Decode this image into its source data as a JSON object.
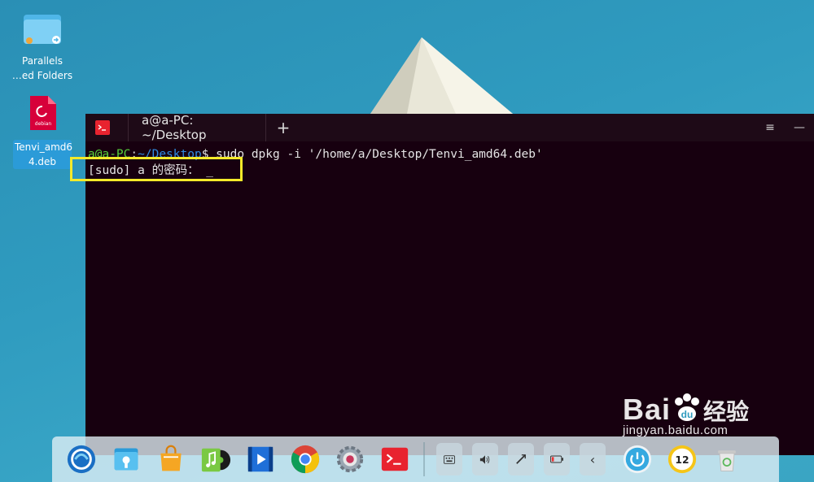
{
  "desktop": {
    "icons": [
      {
        "label": "Parallels\n…ed Folders"
      },
      {
        "label": "Tenvi_amd6\n4.deb",
        "badge": "debian"
      }
    ]
  },
  "terminal": {
    "tab_title": "a@a-PC: ~/Desktop",
    "new_tab": "+",
    "menu_glyph": "≡",
    "minimize_glyph": "—",
    "prompt_user": "a@a-PC",
    "prompt_colon": ":",
    "prompt_path": "~/Desktop",
    "prompt_symbol": "$",
    "command": " sudo dpkg -i '/home/a/Desktop/Tenvi_amd64.deb'",
    "line2": "[sudo] a 的密码： _"
  },
  "dock": {
    "apps": [
      "launcher-icon",
      "file-manager-icon",
      "app-store-icon",
      "music-icon",
      "video-icon",
      "chrome-icon",
      "settings-icon",
      "terminal-icon"
    ],
    "tray": [
      "keyboard-icon",
      "volume-icon",
      "network-icon",
      "battery-icon",
      "expand-icon"
    ],
    "clock": "12"
  },
  "watermark": {
    "brand": "Bai",
    "brand2": "经验",
    "url": "jingyan.baidu.com"
  },
  "colors": {
    "prompt_user": "#57d13b",
    "prompt_path": "#2f8ae0",
    "terminal_bg": "#17000f",
    "highlight": "#f4ea2a"
  }
}
